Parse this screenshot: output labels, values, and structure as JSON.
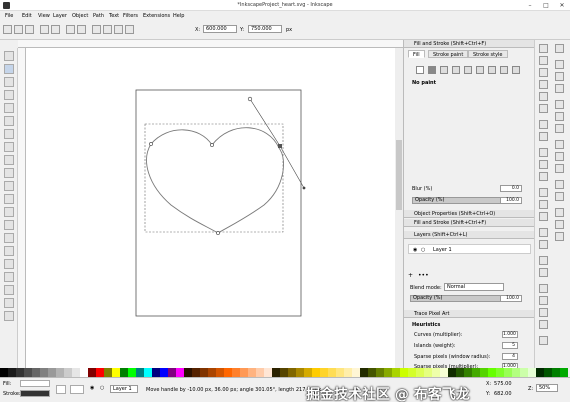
{
  "window": {
    "title": "*InkscapeProject_heart.svg - Inkscape"
  },
  "menubar": [
    "File",
    "Edit",
    "View",
    "Layer",
    "Object",
    "Path",
    "Text",
    "Filters",
    "Extensions",
    "Help"
  ],
  "toolbar": {
    "x_label": "X:",
    "x_value": "600.000",
    "y_label": "Y:",
    "y_value": "750.000",
    "unit": "px"
  },
  "fill_stroke": {
    "title": "Fill and Stroke (Shift+Ctrl+F)",
    "tabs": [
      "Fill",
      "Stroke paint",
      "Stroke style"
    ],
    "status": "No paint",
    "blur_label": "Blur (%)",
    "blur_value": "0.0",
    "opacity_label": "Opacity (%)",
    "opacity_value": "100.0"
  },
  "collapsed_panels": [
    "Object Properties (Shift+Ctrl+O)",
    "Fill and Stroke (Shift+Ctrl+F)"
  ],
  "layers": {
    "title": "Layers (Shift+Ctrl+L)",
    "items": [
      "Layer 1"
    ],
    "blend_label": "Blend mode:",
    "blend_value": "Normal",
    "opacity_label": "Opacity (%)",
    "opacity_value": "100.0"
  },
  "trace": {
    "title": "Trace Pixel Art",
    "section": "Heuristics",
    "rows": [
      {
        "label": "Curves (multiplier):",
        "value": "1.000"
      },
      {
        "label": "Islands (weight):",
        "value": "5"
      },
      {
        "label": "Sparse pixels (window radius):",
        "value": "4"
      },
      {
        "label": "Sparse pixels (multiplier):",
        "value": "1.000"
      }
    ]
  },
  "status": {
    "fill_label": "Fill:",
    "stroke_label": "Stroke:",
    "layer": "Layer 1",
    "message": "Move handle by -10.00 px, 36.00 px; angle 301.05°, length 217.12 px",
    "x_label": "X:",
    "x_value": "575.00",
    "y_label": "Y:",
    "y_value": "682.00",
    "zoom_label": "Z:",
    "zoom_value": "50%"
  },
  "watermark": "掘金技术社区 @ 布客飞龙",
  "colors": {
    "accent": "#b8c8e0",
    "canvas": "#ffffff",
    "chrome": "#f0f0f0"
  }
}
